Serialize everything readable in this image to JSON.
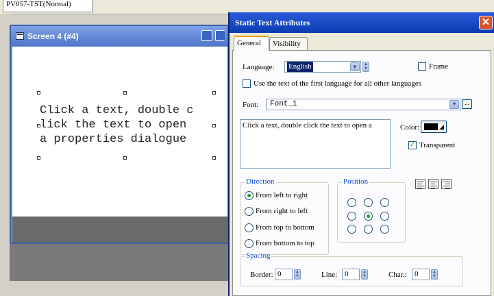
{
  "app": {
    "tab_label": "PV057-TST(Normal)"
  },
  "screen_window": {
    "title": "Screen 4 (#4)",
    "canvas_text": "Click a text, double c\nlick the text to open\na properties dialogue"
  },
  "dialog": {
    "title": "Static Text Attributes",
    "close_label": "✕",
    "tabs": [
      {
        "label": "General",
        "active": true
      },
      {
        "label": "Visibility",
        "active": false
      }
    ],
    "general": {
      "language_label": "Language:",
      "language_value": "English",
      "frame_label": "Frame",
      "frame_checked": false,
      "use_first_language_label": "Use the text of the first language for all other languages",
      "use_first_language_checked": false,
      "font_label": "Font:",
      "font_value": "Font_1",
      "font_button_label": "...",
      "text_value": "Click a text, double click the text to open a",
      "color_label": "Color:",
      "color_value": "#000000",
      "transparent_label": "Transparent",
      "transparent_checked": true,
      "direction": {
        "title": "Direction",
        "options": [
          {
            "label": "From left to right",
            "selected": true
          },
          {
            "label": "From right to left",
            "selected": false
          },
          {
            "label": "From top to bottom",
            "selected": false
          },
          {
            "label": "From bottom to top",
            "selected": false
          }
        ]
      },
      "position": {
        "title": "Position",
        "selected_row": 1,
        "selected_col": 1
      },
      "spacing": {
        "title": "Spacing",
        "border_label": "Border:",
        "border_value": "0",
        "line_label": "Line:",
        "line_value": "0",
        "char_label": "Char.:",
        "char_value": "0"
      }
    }
  }
}
